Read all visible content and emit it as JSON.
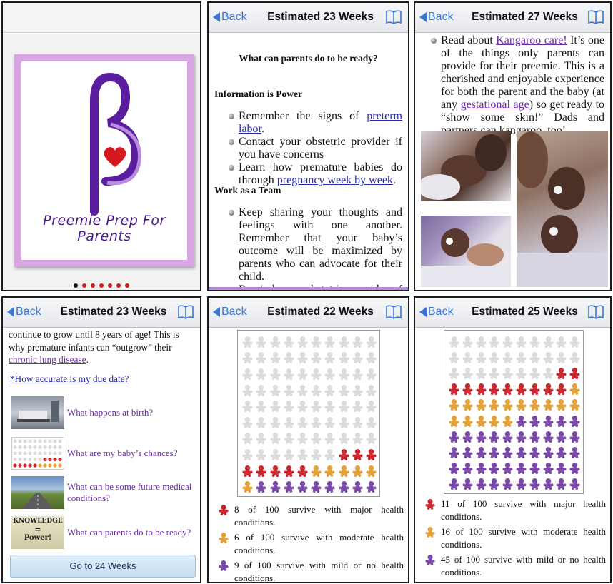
{
  "colors": {
    "link_blue": "#3a76d6",
    "major": "#c8282e",
    "moderate": "#e3a23a",
    "mild": "#7c4aa8",
    "empty": "#dcdcdc",
    "logo_purple": "#5a1e9e",
    "logo_heart": "#d6191f"
  },
  "panel1": {
    "logo_text": "Preemie Prep For Parents",
    "page_dots": 7,
    "active_dot": 0
  },
  "panel2": {
    "back": "Back",
    "title": "Estimated 23 Weeks",
    "heading": "What can parents do to be ready?",
    "section1": "Information is Power",
    "bullets1": [
      {
        "pre": "Remember the signs of ",
        "link": "preterm labor",
        "post": "."
      },
      {
        "pre": "Contact your obstetric provider if you have concerns",
        "link": "",
        "post": ""
      },
      {
        "pre": "Learn how premature babies do through ",
        "link": "pregnancy week by week",
        "post": "."
      }
    ],
    "section2": "Work as a Team",
    "bullets2": [
      "Keep sharing your thoughts and feelings with one another. Remember that your baby’s outcome will be maximized by parents who can advocate for their child.",
      "Remind your obstetric provider of your decisions and preferences."
    ]
  },
  "panel3": {
    "back": "Back",
    "title": "Estimated 27 Weeks",
    "t1": "Read about ",
    "link1": "Kangaroo care!",
    "t2": " It’s one of the things only parents can provide for their preemie. This is a cherished and enjoyable experience for both the parent and the baby (at any ",
    "link2": "gestational age",
    "t3": ") so get ready to “show some skin!” Dads and partners can kangaroo, too!"
  },
  "panel4": {
    "back": "Back",
    "title": "Estimated 23 Weeks",
    "t1": "continue to grow until 8 years of age! This is why premature infants can “outgrow” their ",
    "link1": "chronic lung disease",
    "t2": ".",
    "due_link": "*How accurate is my due date?",
    "topics": [
      {
        "label": "What happens at birth?",
        "thumb": "hospital-room"
      },
      {
        "label": "What are my baby’s chances?",
        "thumb": "pictograph"
      },
      {
        "label": "What can be some future medical conditions?",
        "thumb": "road-landscape"
      },
      {
        "label": "What can parents do to be ready?",
        "thumb": "knowledge-power"
      }
    ],
    "knowledge_top": "KNOWLEDGE",
    "knowledge_eq": "=",
    "knowledge_bottom": "Power!",
    "go_button": "Go to 24 Weeks"
  },
  "panel5": {
    "back": "Back",
    "title": "Estimated 22 Weeks",
    "counts": {
      "major": 8,
      "moderate": 6,
      "mild": 9
    },
    "legend": [
      "8 of 100 survive with major health conditions.",
      "6 of 100 survive with moderate health conditions.",
      "9 of 100 survive with mild or no health conditions."
    ]
  },
  "panel6": {
    "back": "Back",
    "title": "Estimated 25 Weeks",
    "counts": {
      "major": 11,
      "moderate": 16,
      "mild": 45
    },
    "legend": [
      "11 of 100 survive with major health conditions.",
      "16 of 100 survive with moderate health conditions.",
      "45 of 100 survive with mild or no health conditions."
    ]
  }
}
